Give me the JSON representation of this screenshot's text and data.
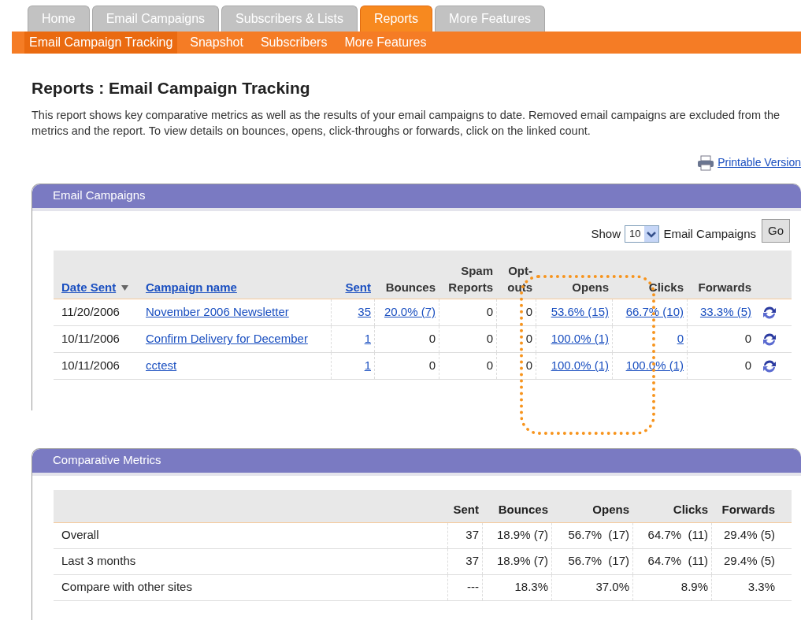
{
  "tabs": [
    {
      "label": "Home",
      "selected": false
    },
    {
      "label": "Email Campaigns",
      "selected": false
    },
    {
      "label": "Subscribers & Lists",
      "selected": false
    },
    {
      "label": "Reports",
      "selected": true
    },
    {
      "label": "More Features",
      "selected": false
    }
  ],
  "subnav": [
    {
      "label": "Email Campaign Tracking",
      "selected": true
    },
    {
      "label": "Snapshot",
      "selected": false
    },
    {
      "label": "Subscribers",
      "selected": false
    },
    {
      "label": "More Features",
      "selected": false
    }
  ],
  "page_title": "Reports : Email Campaign Tracking",
  "description": "This report shows key comparative metrics as well as the results of your email campaigns to date. Removed email campaigns are excluded from the metrics and the report. To view details on bounces, opens, click-throughs or forwards, click on the linked count.",
  "printable_link": "Printable Version",
  "campaigns_panel": {
    "title": "Email Campaigns",
    "show_label": "Show",
    "show_value": "10",
    "show_suffix": "Email Campaigns",
    "go_button": "Go",
    "columns": [
      {
        "label": "Date Sent",
        "link": true,
        "sorted": true
      },
      {
        "label": "Campaign name",
        "link": true,
        "sorted": false
      },
      {
        "label": "Sent",
        "link": true,
        "sorted": false
      },
      {
        "label": "Bounces",
        "link": false,
        "sorted": false
      },
      {
        "label": "Spam Reports",
        "link": false,
        "sorted": false
      },
      {
        "label": "Opt-outs",
        "link": false,
        "sorted": false
      },
      {
        "label": "Opens",
        "link": false,
        "sorted": false
      },
      {
        "label": "Clicks",
        "link": false,
        "sorted": false
      },
      {
        "label": "Forwards",
        "link": false,
        "sorted": false
      }
    ],
    "rows": [
      {
        "cells": [
          {
            "text": "11/20/2006",
            "link": false
          },
          {
            "text": "November 2006 Newsletter",
            "link": true
          },
          {
            "text": "35",
            "link": true
          },
          {
            "text": "20.0% (7)",
            "link": true
          },
          {
            "text": "0",
            "link": false
          },
          {
            "text": "0",
            "link": false
          },
          {
            "text": "53.6% (15)",
            "link": true
          },
          {
            "text": "66.7% (10)",
            "link": true
          },
          {
            "text": "33.3% (5)",
            "link": true
          }
        ]
      },
      {
        "cells": [
          {
            "text": "10/11/2006",
            "link": false
          },
          {
            "text": "Confirm Delivery for December",
            "link": true
          },
          {
            "text": "1",
            "link": true
          },
          {
            "text": "0",
            "link": false
          },
          {
            "text": "0",
            "link": false
          },
          {
            "text": "0",
            "link": false
          },
          {
            "text": "100.0% (1)",
            "link": true
          },
          {
            "text": "0",
            "link": true
          },
          {
            "text": "0",
            "link": false
          }
        ]
      },
      {
        "cells": [
          {
            "text": "10/11/2006",
            "link": false
          },
          {
            "text": "cctest",
            "link": true
          },
          {
            "text": "1",
            "link": true
          },
          {
            "text": "0",
            "link": false
          },
          {
            "text": "0",
            "link": false
          },
          {
            "text": "0",
            "link": false
          },
          {
            "text": "100.0% (1)",
            "link": true
          },
          {
            "text": "100.0% (1)",
            "link": true
          },
          {
            "text": "0",
            "link": false
          }
        ]
      }
    ]
  },
  "metrics_panel": {
    "title": "Comparative Metrics",
    "columns": [
      "Sent",
      "Bounces",
      "Opens",
      "Clicks",
      "Forwards"
    ],
    "rows": [
      {
        "label": "Overall",
        "values": [
          "37",
          "18.9% (7)",
          "56.7%  (17)",
          "64.7%  (11)",
          "29.4% (5)"
        ]
      },
      {
        "label": "Last 3 months",
        "values": [
          "37",
          "18.9% (7)",
          "56.7%  (17)",
          "64.7%  (11)",
          "29.4% (5)"
        ]
      },
      {
        "label": "Compare with other sites",
        "values": [
          "---",
          "18.3%",
          "37.0%",
          "8.9%",
          "3.3%"
        ]
      }
    ]
  }
}
